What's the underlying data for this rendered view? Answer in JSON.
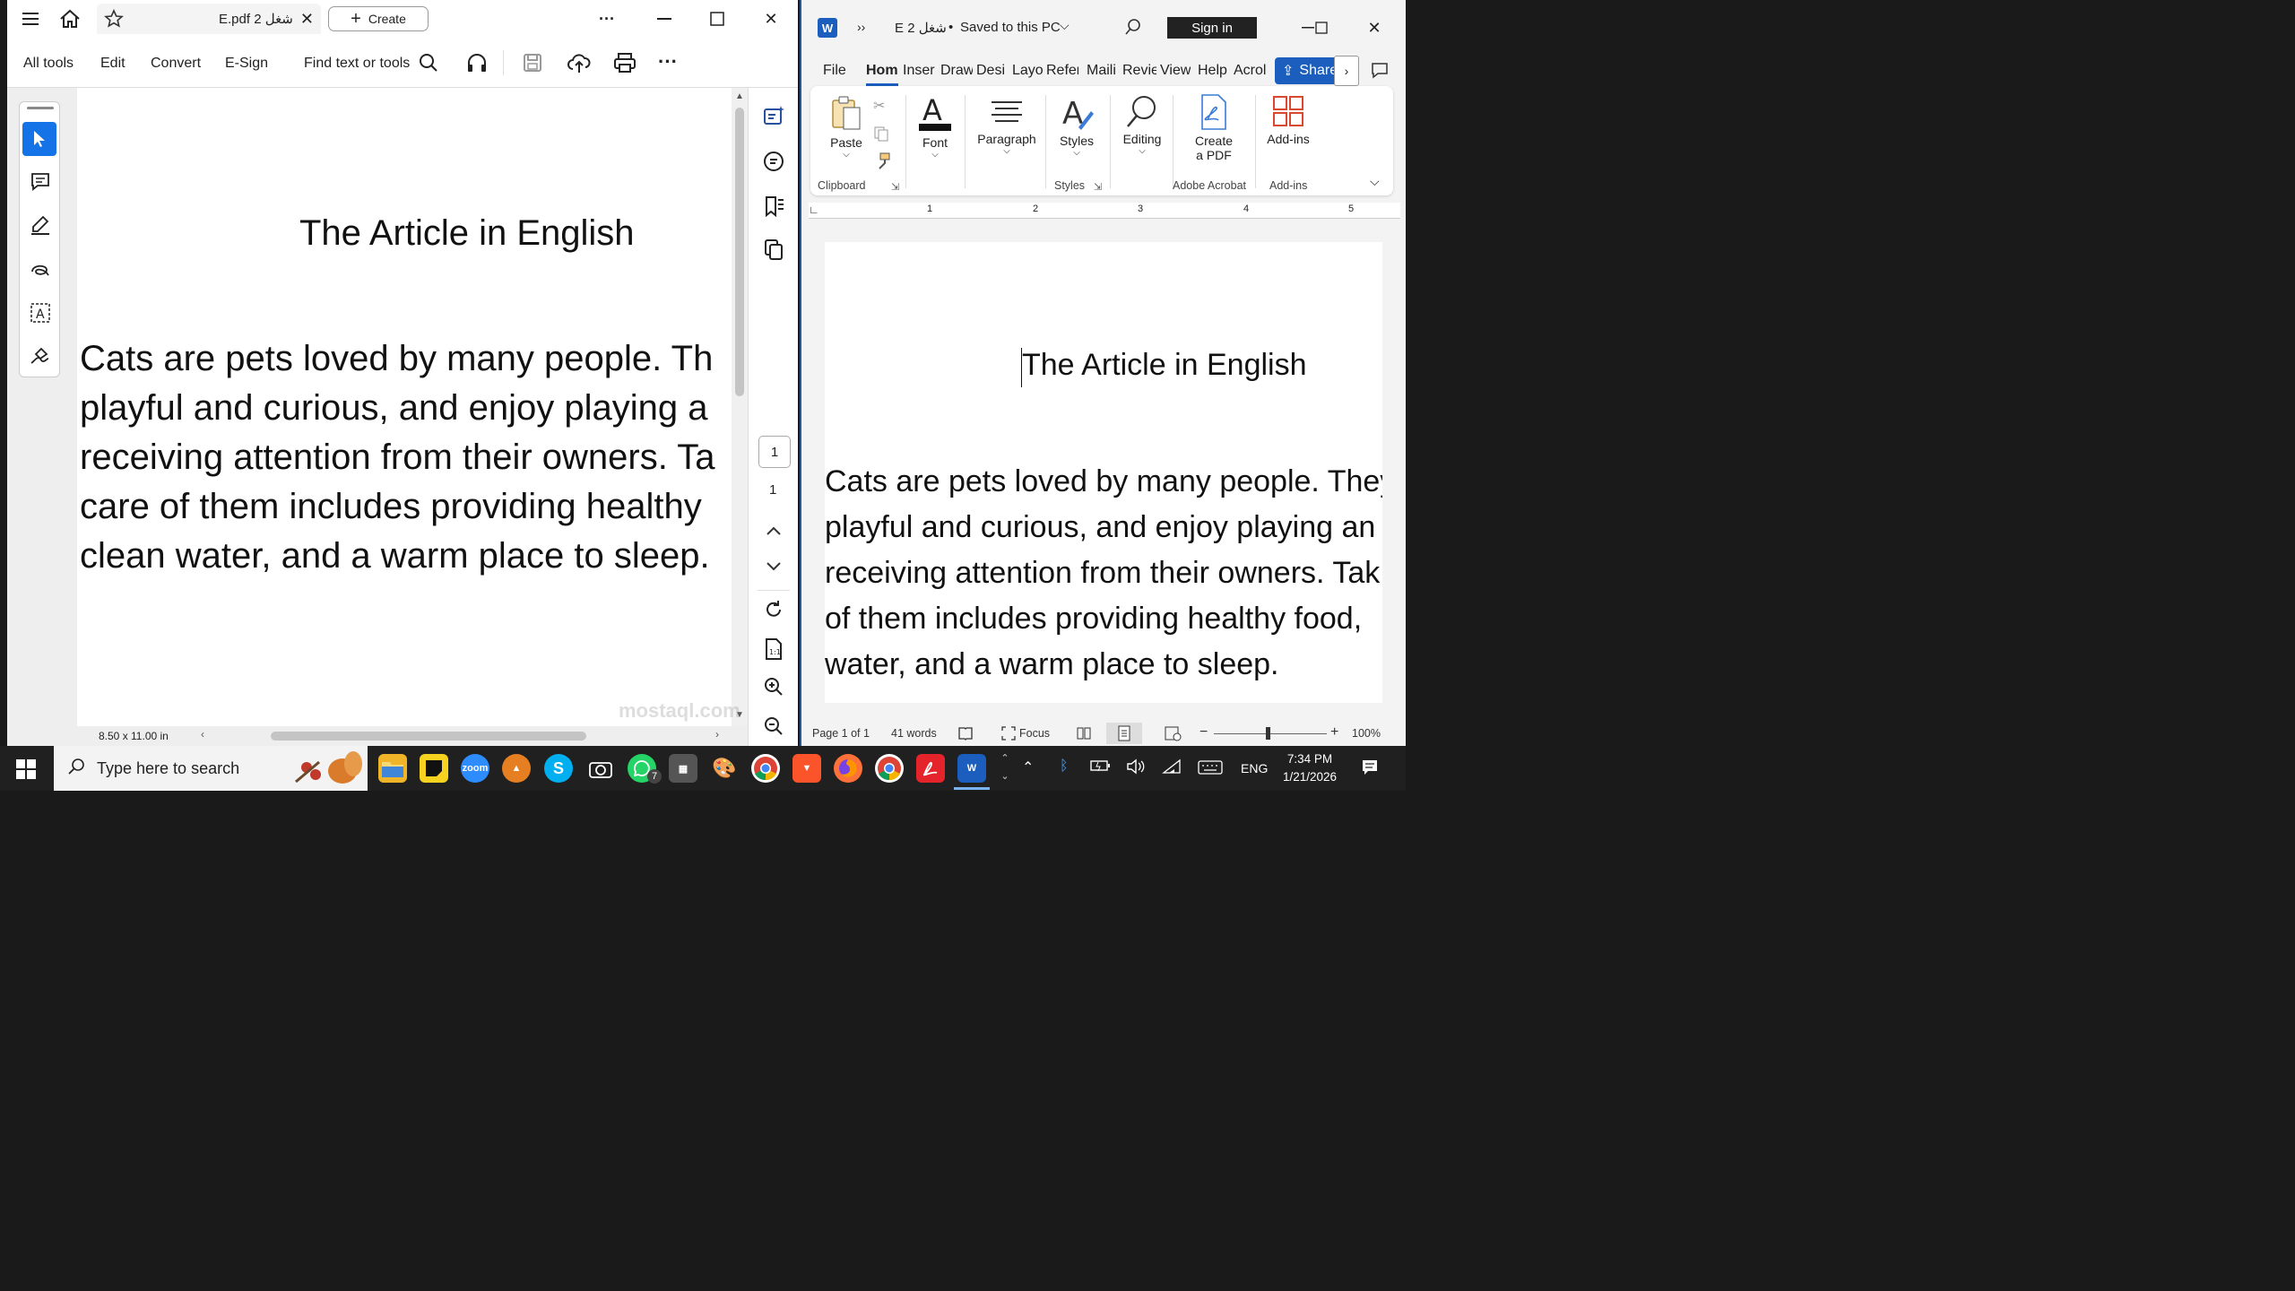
{
  "acrobat": {
    "tab_title": "E.pdf شغل 2",
    "create_label": "Create",
    "menu": [
      "All tools",
      "Edit",
      "Convert",
      "E-Sign"
    ],
    "find_label": "Find text or tools",
    "doc_title": "The Article in English",
    "body_lines": [
      "Cats are pets loved by many people. Th",
      "playful and curious, and enjoy playing a",
      "receiving attention from their owners. Ta",
      "care of them includes providing healthy",
      "clean water, and a warm place to sleep."
    ],
    "page_box": "1",
    "page_total": "1",
    "page_size": "8.50 x 11.00 in"
  },
  "word": {
    "doc_name": "E شغل 2",
    "save_status": "Saved to this PC",
    "sign_in": "Sign in",
    "tabs": [
      "File",
      "Hom",
      "Inser",
      "Draw",
      "Desi",
      "Layo",
      "Refer",
      "Maili",
      "Revie",
      "View",
      "Help",
      "Acrol"
    ],
    "share": "Share",
    "ribbon": {
      "paste": "Paste",
      "font": "Font",
      "paragraph": "Paragraph",
      "styles": "Styles",
      "editing": "Editing",
      "create_pdf_1": "Create",
      "create_pdf_2": "a PDF",
      "addins": "Add-ins",
      "g_clipboard": "Clipboard",
      "g_styles": "Styles",
      "g_acrobat": "Adobe Acrobat",
      "g_addins": "Add-ins"
    },
    "ruler_nums": [
      "1",
      "2",
      "3",
      "4",
      "5"
    ],
    "doc_title": "The Article in English",
    "body_lines": [
      "Cats are pets loved by many people. They",
      "playful and curious, and enjoy playing an",
      "receiving attention from their owners. Tak",
      "of them includes providing healthy food,",
      "water, and a warm place to sleep."
    ],
    "status": {
      "page": "Page 1 of 1",
      "words": "41 words",
      "focus": "Focus",
      "zoom": "100%"
    }
  },
  "taskbar": {
    "search_placeholder": "Type here to search",
    "zoom_label": "zoom",
    "whatsapp_badge": "7",
    "lang": "ENG",
    "time": "7:34 PM",
    "date": "1/21/2026"
  },
  "watermark": "mostaql.com"
}
